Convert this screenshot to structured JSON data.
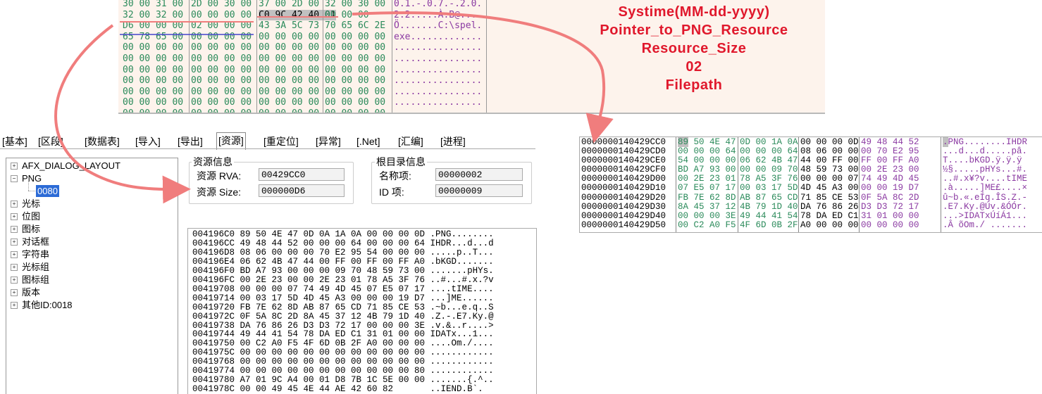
{
  "top_hex": {
    "rows": [
      {
        "g1": "30 00 31 00",
        "g2": "2D 00 30 00",
        "g3": "37 00 2D 00",
        "g4": "32 00 30 00",
        "ascii": "0.1.-.0.7.-.2.0."
      },
      {
        "g1": "32 00 32 00",
        "g2": "00 00 00 00",
        "g3a": "C0 9C 42 40",
        "g3b": "01",
        "g3c": "00 00 00",
        "g4": "",
        "ascii": "2.2.....À.B@...."
      },
      {
        "g1": "D6 00 00 00",
        "g2": "02 00 00 00",
        "g3": "43 3A 5C 73",
        "g4": "70 65 6C 2E",
        "ascii": "Ö.......C:\\spel."
      },
      {
        "g1": "65 78 65 00",
        "g2": "00 00 00 00",
        "g3": "00 00 00 00",
        "g4": "00 00 00 00",
        "ascii": "exe............."
      },
      {
        "g1": "00 00 00 00",
        "g2": "00 00 00 00",
        "g3": "00 00 00 00",
        "g4": "00 00 00 00",
        "ascii": "................"
      },
      {
        "g1": "00 00 00 00",
        "g2": "00 00 00 00",
        "g3": "00 00 00 00",
        "g4": "00 00 00 00",
        "ascii": "................"
      },
      {
        "g1": "00 00 00 00",
        "g2": "00 00 00 00",
        "g3": "00 00 00 00",
        "g4": "00 00 00 00",
        "ascii": "................"
      },
      {
        "g1": "00 00 00 00",
        "g2": "00 00 00 00",
        "g3": "00 00 00 00",
        "g4": "00 00 00 00",
        "ascii": "................"
      },
      {
        "g1": "00 00 00 00",
        "g2": "00 00 00 00",
        "g3": "00 00 00 00",
        "g4": "00 00 00 00",
        "ascii": "................"
      },
      {
        "g1": "00 00 00 00",
        "g2": "00 00 00 00",
        "g3": "00 00 00 00",
        "g4": "00 00 00 00",
        "ascii": "................"
      },
      {
        "g1": "00 00 00 00",
        "g2": "00 00 00 00",
        "g3": "00 00 00 00",
        "g4": "00 00 00 00",
        "ascii": "................"
      }
    ]
  },
  "annotations": [
    "Systime(MM-dd-yyyy)",
    "Pointer_to_PNG_Resource",
    "Resource_Size",
    "02",
    "Filepath"
  ],
  "tabs": [
    "[基本]",
    "[区段]",
    "[数据表]",
    "[导入]",
    "[导出]",
    "[资源]",
    "[重定位]",
    "[异常]",
    "[.Net]",
    "[汇编]",
    "[进程]"
  ],
  "active_tab": "[资源]",
  "tree": {
    "items": [
      "AFX_DIALOG_LAYOUT",
      "PNG",
      "0080",
      "光标",
      "位图",
      "图标",
      "对话框",
      "字符串",
      "光标组",
      "图标组",
      "版本",
      "其他ID:0018"
    ]
  },
  "resource_info": {
    "title": "资源信息",
    "rva_label": "资源 RVA:",
    "rva_value": "00429CC0",
    "size_label": "资源 Size:",
    "size_value": "000000D6"
  },
  "root_info": {
    "title": "根目录信息",
    "name_label": "名称项:",
    "name_value": "00000002",
    "id_label": "ID  项:",
    "id_value": "00000009"
  },
  "bottom_hex": {
    "lines": [
      "004196C0 89 50 4E 47 0D 0A 1A 0A 00 00 00 0D .PNG........",
      "004196CC 49 48 44 52 00 00 00 64 00 00 00 64 IHDR...d...d",
      "004196D8 08 06 00 00 00 70 E2 95 54 00 00 00 .....p..T...",
      "004196E4 06 62 4B 47 44 00 FF 00 FF 00 FF A0 .bKGD.......",
      "004196F0 BD A7 93 00 00 00 09 70 48 59 73 00 .......pHYs.",
      "004196FC 00 2E 23 00 00 2E 23 01 78 A5 3F 76 ..#...#.x.?v",
      "00419708 00 00 00 07 74 49 4D 45 07 E5 07 17 ....tIME....",
      "00419714 00 03 17 5D 4D 45 A3 00 00 00 19 D7 ...]ME......",
      "00419720 FB 7E 62 8D AB 87 65 CD 71 85 CE 53 .~b...e.q..S",
      "0041972C 0F 5A 8C 2D 8A 45 37 12 4B 79 1D 40 .Z.-.E7.Ky.@",
      "00419738 DA 76 86 26 D3 D3 72 17 00 00 00 3E .v.&..r....>",
      "00419744 49 44 41 54 78 DA ED C1 31 01 00 00 IDATx...1...",
      "00419750 00 C2 A0 F5 4F 6D 0B 2F A0 00 00 00 ....Om./....",
      "0041975C 00 00 00 00 00 00 00 00 00 00 00 00 ............",
      "00419768 00 00 00 00 00 00 00 00 00 00 00 00 ............",
      "00419774 00 00 00 00 00 00 00 00 00 00 00 80 ............",
      "00419780 A7 01 9C A4 00 01 D8 7B 1C 5E 00 00 .......{.^..",
      "0041978C 00 00 49 45 4E 44 AE 42 60 82       ..IEND.B`."
    ]
  },
  "right_hex": {
    "rows": [
      {
        "addr": "0000000140429CC0",
        "g1": "89 50 4E 47",
        "g2": "0D 00 1A 0A",
        "g3": "00 00 00 0D",
        "g4": "49 48 44 52",
        "ascii": ".PNG........IHDR"
      },
      {
        "addr": "0000000140429CD0",
        "g1": "00 00 00 64",
        "g2": "00 00 00 64",
        "g3": "08 06 00 00",
        "g4": "00 70 E2 95",
        "ascii": "...d...d.....pâ."
      },
      {
        "addr": "0000000140429CE0",
        "g1": "54 00 00 00",
        "g2": "06 62 4B 47",
        "g3": "44 00 FF 00",
        "g4": "FF 00 FF A0",
        "ascii": "T....bKGD.ÿ.ÿ.ÿ "
      },
      {
        "addr": "0000000140429CF0",
        "g1": "BD A7 93 00",
        "g2": "00 00 09 70",
        "g3": "48 59 73 00",
        "g4": "00 2E 23 00",
        "ascii": "½§.....pHYs...#."
      },
      {
        "addr": "0000000140429D00",
        "g1": "00 2E 23 01",
        "g2": "78 A5 3F 76",
        "g3": "00 00 00 07",
        "g4": "74 49 4D 45",
        "ascii": "..#.x¥?v....tIME"
      },
      {
        "addr": "0000000140429D10",
        "g1": "07 E5 07 17",
        "g2": "00 03 17 5D",
        "g3": "4D 45 A3 00",
        "g4": "00 00 19 D7",
        "ascii": ".à.....]ME£....×"
      },
      {
        "addr": "0000000140429D20",
        "g1": "FB 7E 62 8D",
        "g2": "AB 87 65 CD",
        "g3": "71 85 CE 53",
        "g4": "0F 5A 8C 2D",
        "ascii": "û~b.«.eÍq.ÎS.Z.-"
      },
      {
        "addr": "0000000140429D30",
        "g1": "8A 45 37 12",
        "g2": "4B 79 1D 40",
        "g3": "DA 76 86 26",
        "g4": "D3 D3 72 17",
        "ascii": ".E7.Ky.@Úv.&ÓÓr."
      },
      {
        "addr": "0000000140429D40",
        "g1": "00 00 00 3E",
        "g2": "49 44 41 54",
        "g3": "78 DA ED C1",
        "g4": "31 01 00 00",
        "ascii": "...>IDATxÚíÁ1..."
      },
      {
        "addr": "0000000140429D50",
        "g1": "00 C2 A0 F5",
        "g2": "4F 6D 0B 2F",
        "g3": "A0 00 00 00",
        "g4": "00 00 00 00",
        "ascii": ".Â õOm./ ......."
      }
    ]
  },
  "colors": {
    "annotation": "#e0182c",
    "arrow": "#f07d7d",
    "hex_green": "#2a8a5a",
    "hex_purple": "#8b3aa2",
    "hex_blue": "#3a56b0",
    "panel_bg": "#fdf3ec"
  }
}
